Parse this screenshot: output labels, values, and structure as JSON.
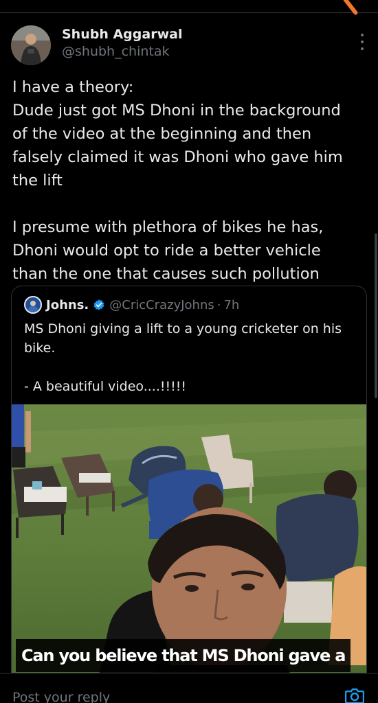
{
  "tweet": {
    "display_name": "Shubh Aggarwal",
    "handle": "@shubh_chintak",
    "body_lines": [
      "I have a theory:",
      "Dude just got MS Dhoni in the background",
      "of the video at the beginning and then",
      "falsely claimed it was Dhoni who gave him",
      "the lift",
      "",
      "I presume with plethora of bikes he has,",
      "Dhoni would opt to ride a better vehicle",
      "than the one that causes such pollution"
    ]
  },
  "quoted_tweet": {
    "display_name": "Johns.",
    "handle": "@CricCrazyJohns",
    "separator": "·",
    "time": "7h",
    "verified": true,
    "body_lines": [
      "MS Dhoni giving a lift to a young cricketer on his",
      "bike.",
      "",
      "- A beautiful video....!!!!!"
    ],
    "video_caption": "Can you believe that MS Dhoni gave a"
  },
  "reply_bar": {
    "placeholder": "Post your reply"
  },
  "icons": {
    "more": "more-vertical-icon",
    "verified": "verified-badge-icon",
    "camera": "camera-icon"
  },
  "colors": {
    "background": "#000000",
    "text": "#e7e9ea",
    "secondary_text": "#71767b",
    "accent": "#1d9bf0",
    "divider": "#2f3336"
  }
}
